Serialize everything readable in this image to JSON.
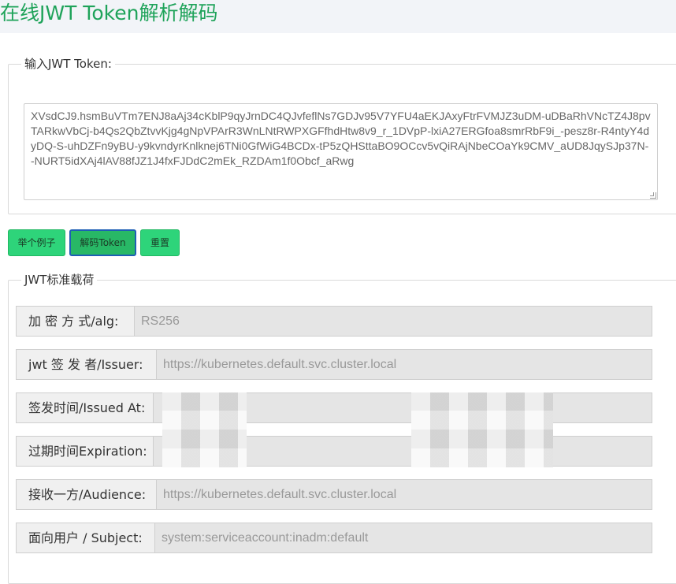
{
  "page": {
    "title": "在线JWT Token解析解码"
  },
  "token_section": {
    "legend": "输入JWT Token:",
    "token_text": "XVsdCJ9.hsmBuVTm7ENJ8aAj34cKblP9qyJrnDC4QJvfeflNs7GDJv95V7YFU4aEKJAxyFtrFVMJZ3uDM-uDBaRhVNcTZ4J8pvTARkwVbCj-b4Qs2QbZtvvKjg4gNpVPArR3WnLNtRWPXGFfhdHtw8v9_r_1DVpP-lxiA27ERGfoa8smrRbF9i_-pesz8r-R4ntyY4dyDQ-S-uhDZFn9yBU-y9kvndyrKnlknej6TNi0GfWiG4BCDx-tP5zQHSttaBO9OCcv5vQiRAjNbeCOaYk9CMV_aUD8JqySJp37N--NURT5idXAj4lAV88fJZ1J4fxFJDdC2mEk_RZDAm1f0Obcf_aRwg"
  },
  "buttons": {
    "example": "举个例子",
    "decode": "解码Token",
    "reset": "重置"
  },
  "payload_section": {
    "legend": "JWT标准载荷",
    "rows": [
      {
        "label": "加 密 方 式/alg:",
        "value": "RS256"
      },
      {
        "label": "jwt 签 发 者/Issuer:",
        "value": "https://kubernetes.default.svc.cluster.local"
      },
      {
        "label": "签发时间/Issued At:",
        "value": ""
      },
      {
        "label": "过期时间Expiration:",
        "value": ""
      },
      {
        "label": "接收一方/Audience:",
        "value": "https://kubernetes.default.svc.cluster.local"
      },
      {
        "label": "面向用户 / Subject:",
        "value": "system:serviceaccount:inadm:default"
      }
    ]
  },
  "colors": {
    "title": "#1fa35a",
    "button": "#2ed47a",
    "field_bg": "#e5e5e5"
  }
}
